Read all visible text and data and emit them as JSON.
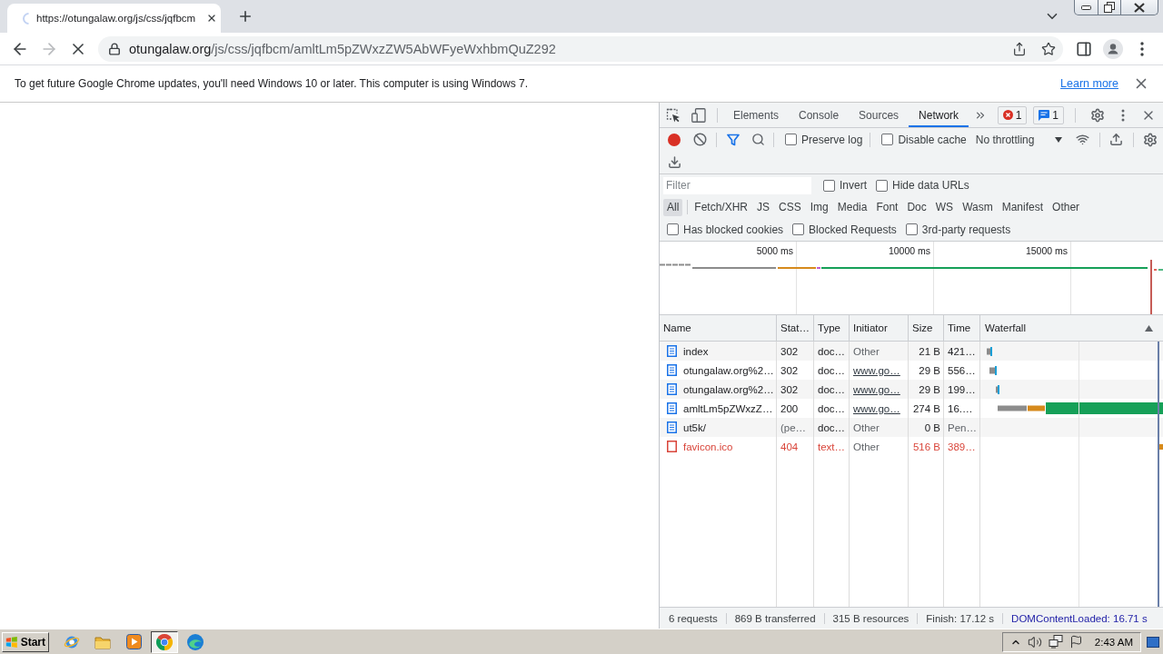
{
  "browser_tab": {
    "title": "https://otungalaw.org/js/css/jqfbcm"
  },
  "address_bar": {
    "host": "otungalaw.org",
    "path": "/js/css/jqfbcm/amltLm5pZWxzZW5AbWFyeWxhbmQuZ292"
  },
  "infobar": {
    "message": "To get future Google Chrome updates, you'll need Windows 10 or later. This computer is using Windows 7.",
    "link": "Learn more"
  },
  "devtools": {
    "panel_tabs": [
      {
        "label": "Elements",
        "selected": false
      },
      {
        "label": "Console",
        "selected": false
      },
      {
        "label": "Sources",
        "selected": false
      },
      {
        "label": "Network",
        "selected": true
      }
    ],
    "issue_counts": {
      "errors": "1",
      "messages": "1"
    },
    "network_toolbar": {
      "recording": true,
      "preserve_log": {
        "label": "Preserve log",
        "checked": false
      },
      "disable_cache": {
        "label": "Disable cache",
        "checked": false
      },
      "throttling": "No throttling"
    },
    "filter_bar": {
      "placeholder": "Filter",
      "invert": {
        "label": "Invert",
        "checked": false
      },
      "hide_data_urls": {
        "label": "Hide data URLs",
        "checked": false
      },
      "types": [
        {
          "label": "All",
          "selected": true
        },
        {
          "label": "Fetch/XHR",
          "selected": false
        },
        {
          "label": "JS",
          "selected": false
        },
        {
          "label": "CSS",
          "selected": false
        },
        {
          "label": "Img",
          "selected": false
        },
        {
          "label": "Media",
          "selected": false
        },
        {
          "label": "Font",
          "selected": false
        },
        {
          "label": "Doc",
          "selected": false
        },
        {
          "label": "WS",
          "selected": false
        },
        {
          "label": "Wasm",
          "selected": false
        },
        {
          "label": "Manifest",
          "selected": false
        },
        {
          "label": "Other",
          "selected": false
        }
      ],
      "options": [
        {
          "label": "Has blocked cookies",
          "checked": false
        },
        {
          "label": "Blocked Requests",
          "checked": false
        },
        {
          "label": "3rd-party requests",
          "checked": false
        }
      ]
    },
    "overview": {
      "ticks": [
        "5000 ms",
        "10000 ms",
        "15000 ms"
      ]
    },
    "requests": {
      "columns": [
        "Name",
        "Stat…",
        "Type",
        "Initiator",
        "Size",
        "Time",
        "Waterfall"
      ],
      "rows": [
        {
          "name": "index",
          "status": "302",
          "type": "doc…",
          "initiator": "Other",
          "initiator_link": false,
          "size": "21 B",
          "time": "421…",
          "pending": false,
          "failed": false
        },
        {
          "name": "otungalaw.org%2…",
          "status": "302",
          "type": "doc…",
          "initiator": "www.go…",
          "initiator_link": true,
          "size": "29 B",
          "time": "556…",
          "pending": false,
          "failed": false
        },
        {
          "name": "otungalaw.org%2…",
          "status": "302",
          "type": "doc…",
          "initiator": "www.go…",
          "initiator_link": true,
          "size": "29 B",
          "time": "199…",
          "pending": false,
          "failed": false
        },
        {
          "name": "amltLm5pZWxzZ…",
          "status": "200",
          "type": "doc…",
          "initiator": "www.go…",
          "initiator_link": true,
          "size": "274 B",
          "time": "16.…",
          "pending": false,
          "failed": false
        },
        {
          "name": "ut5k/",
          "status": "(pe…",
          "type": "doc…",
          "initiator": "Other",
          "initiator_link": false,
          "size": "0 B",
          "time": "Pen…",
          "pending": true,
          "failed": false
        },
        {
          "name": "favicon.ico",
          "status": "404",
          "type": "text…",
          "initiator": "Other",
          "initiator_link": false,
          "size": "516 B",
          "time": "389…",
          "pending": false,
          "failed": true
        }
      ]
    },
    "summary": [
      {
        "text": "6 requests",
        "kind": "stat"
      },
      {
        "text": "869 B transferred",
        "kind": "stat"
      },
      {
        "text": "315 B resources",
        "kind": "stat"
      },
      {
        "text": "Finish: 17.12 s",
        "kind": "stat"
      },
      {
        "text": "DOMContentLoaded: 16.71 s",
        "kind": "dom_content_loaded"
      }
    ]
  },
  "taskbar": {
    "start": "Start",
    "apps": [
      {
        "active": false
      },
      {
        "active": false
      },
      {
        "active": false
      },
      {
        "active": true
      },
      {
        "active": false
      }
    ],
    "clock": "2:43 AM"
  }
}
